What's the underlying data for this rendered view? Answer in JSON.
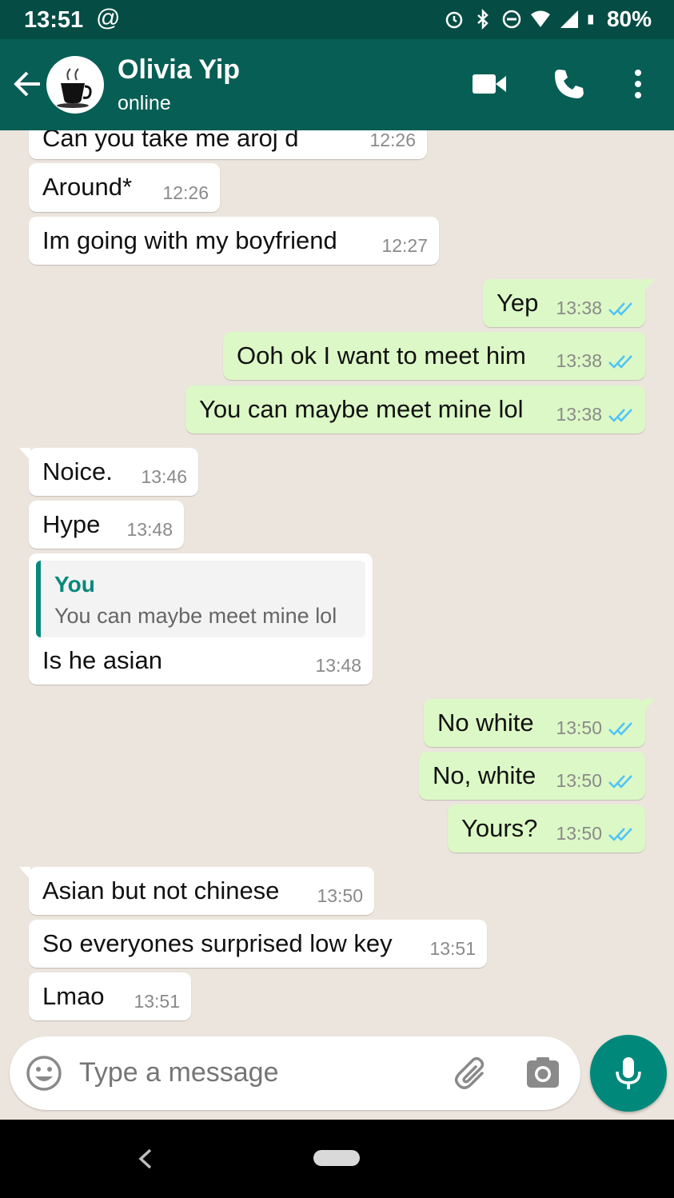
{
  "status_bar": {
    "time": "13:51",
    "battery": "80%"
  },
  "header": {
    "contact_name": "Olivia Yip",
    "status": "online"
  },
  "messages": [
    {
      "dir": "in",
      "text": "Can you take me aroj d",
      "time": "12:26"
    },
    {
      "dir": "in",
      "text": "Around*",
      "time": "12:26"
    },
    {
      "dir": "in",
      "text": "Im going with my boyfriend",
      "time": "12:27"
    },
    {
      "dir": "out",
      "text": "Yep",
      "time": "13:38"
    },
    {
      "dir": "out",
      "text": "Ooh ok I want to meet him",
      "time": "13:38"
    },
    {
      "dir": "out",
      "text": "You can maybe meet mine lol",
      "time": "13:38"
    },
    {
      "dir": "in",
      "text": "Noice.",
      "time": "13:46"
    },
    {
      "dir": "in",
      "text": "Hype",
      "time": "13:48"
    },
    {
      "dir": "in",
      "text": "Is he asian",
      "time": "13:48",
      "quote": {
        "author": "You",
        "text": "You can maybe meet mine lol"
      }
    },
    {
      "dir": "out",
      "text": "No white",
      "time": "13:50"
    },
    {
      "dir": "out",
      "text": "No, white",
      "time": "13:50"
    },
    {
      "dir": "out",
      "text": "Yours?",
      "time": "13:50"
    },
    {
      "dir": "in",
      "text": "Asian but not chinese",
      "time": "13:50"
    },
    {
      "dir": "in",
      "text": "So everyones surprised low key",
      "time": "13:51"
    },
    {
      "dir": "in",
      "text": "Lmao",
      "time": "13:51"
    }
  ],
  "composer": {
    "placeholder": "Type a message"
  },
  "colors": {
    "header": "#075e54",
    "status_bar": "#054d44",
    "outgoing_bubble": "#dcf8c6",
    "incoming_bubble": "#ffffff",
    "accent": "#00897b",
    "read_ticks": "#4fc3f7"
  },
  "icons": {
    "back": "arrow-left-icon",
    "video": "video-camera-icon",
    "call": "phone-icon",
    "menu": "more-vert-icon",
    "emoji": "emoji-icon",
    "attach": "paperclip-icon",
    "camera": "camera-icon",
    "mic": "microphone-icon"
  }
}
